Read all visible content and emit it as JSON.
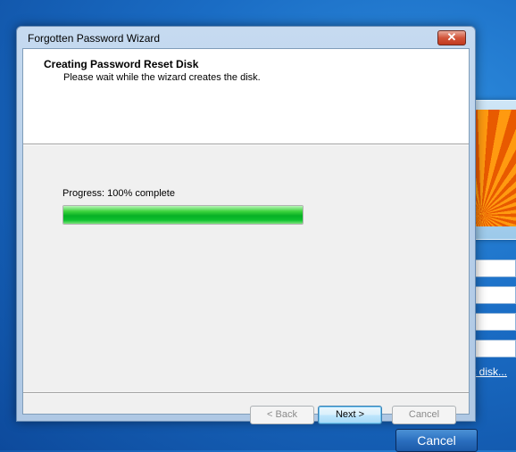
{
  "window": {
    "title": "Forgotten Password Wizard"
  },
  "header": {
    "title": "Creating Password Reset Disk",
    "subtitle": "Please wait while the wizard creates the disk."
  },
  "progress": {
    "label": "Progress: 100% complete",
    "percent": 100,
    "color": "#06b025"
  },
  "buttons": {
    "back": "< Back",
    "next": "Next >",
    "cancel": "Cancel"
  },
  "background": {
    "reset_link": "t disk...",
    "cancel_button": "Cancel"
  }
}
